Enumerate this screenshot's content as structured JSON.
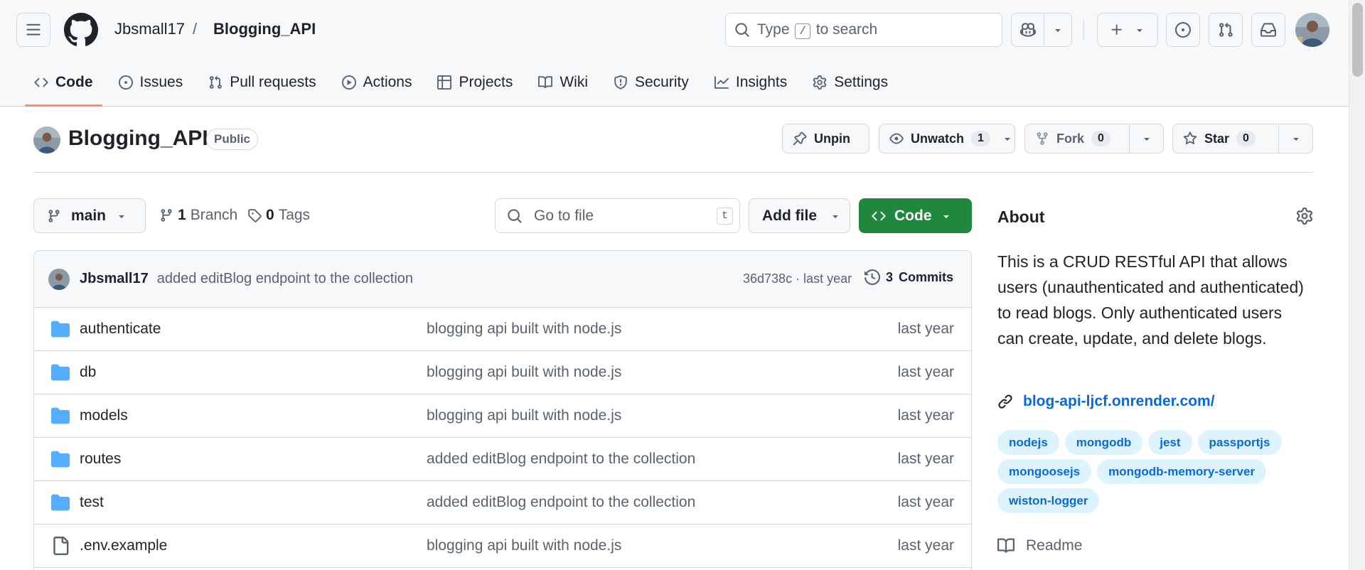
{
  "header": {
    "owner": "Jbsmall17",
    "separator": "/",
    "repo": "Blogging_API",
    "search": {
      "prefix": "Type",
      "key": "/",
      "suffix": "to search"
    }
  },
  "tabs": [
    {
      "label": "Code",
      "icon": "code-icon",
      "active": true
    },
    {
      "label": "Issues",
      "icon": "issue-opened-icon"
    },
    {
      "label": "Pull requests",
      "icon": "git-pull-request-icon"
    },
    {
      "label": "Actions",
      "icon": "play-icon"
    },
    {
      "label": "Projects",
      "icon": "table-icon"
    },
    {
      "label": "Wiki",
      "icon": "book-icon"
    },
    {
      "label": "Security",
      "icon": "shield-icon"
    },
    {
      "label": "Insights",
      "icon": "graph-icon"
    },
    {
      "label": "Settings",
      "icon": "gear-icon"
    }
  ],
  "repo": {
    "name": "Blogging_API",
    "visibility": "Public",
    "actions": {
      "unpin": "Unpin",
      "unwatch": "Unwatch",
      "watch_count": "1",
      "fork": "Fork",
      "fork_count": "0",
      "star": "Star",
      "star_count": "0"
    }
  },
  "filenav": {
    "branch": "main",
    "branches_count": "1",
    "branches_label": "Branch",
    "tags_count": "0",
    "tags_label": "Tags",
    "goto_placeholder": "Go to file",
    "goto_key": "t",
    "add_file": "Add file",
    "code": "Code"
  },
  "commit": {
    "author": "Jbsmall17",
    "message": "added editBlog endpoint to the collection",
    "meta": "36d738c · last year",
    "commits_count": "3",
    "commits_label": "Commits"
  },
  "files": [
    {
      "name": "authenticate",
      "type": "folder",
      "message": "blogging api built with node.js",
      "date": "last year"
    },
    {
      "name": "db",
      "type": "folder",
      "message": "blogging api built with node.js",
      "date": "last year"
    },
    {
      "name": "models",
      "type": "folder",
      "message": "blogging api built with node.js",
      "date": "last year"
    },
    {
      "name": "routes",
      "type": "folder",
      "message": "added editBlog endpoint to the collection",
      "date": "last year"
    },
    {
      "name": "test",
      "type": "folder",
      "message": "added editBlog endpoint to the collection",
      "date": "last year"
    },
    {
      "name": ".env.example",
      "type": "file",
      "message": "blogging api built with node.js",
      "date": "last year"
    }
  ],
  "about": {
    "title": "About",
    "description": "This is a CRUD RESTful API that allows users (unauthenticated and authenticated) to read blogs. Only authenticated users can create, update, and delete blogs.",
    "link": "blog-api-ljcf.onrender.com/",
    "topics": [
      "nodejs",
      "mongodb",
      "jest",
      "passportjs",
      "mongoosejs",
      "mongodb-memory-server",
      "wiston-logger"
    ],
    "readme": "Readme"
  },
  "colors": {
    "accent_underline": "#fd8c73",
    "primary_green": "#1f883d",
    "link_blue": "#0969da",
    "folder_blue": "#54aeff",
    "topic_bg": "#ddf4ff"
  }
}
